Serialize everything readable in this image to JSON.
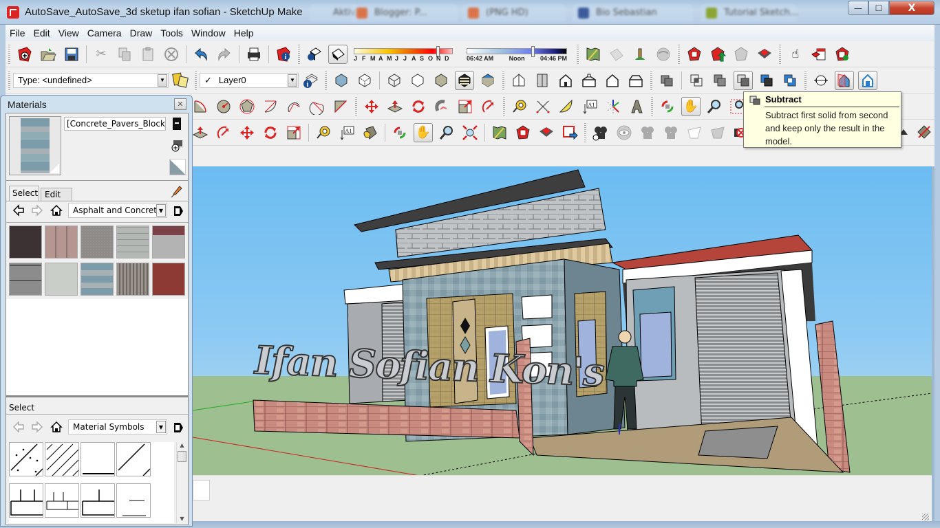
{
  "window": {
    "title": "AutoSave_AutoSave_3d sketup ifan sofian - SketchUp Make",
    "background_tabs": [
      "Aktiv...",
      "Blogger: P...",
      "(PNG HD)",
      "Bio Sebastian",
      "Tutorial Sketch..."
    ],
    "controls": {
      "minimize": "—",
      "maximize": "☐",
      "close": "X"
    }
  },
  "menu": [
    "File",
    "Edit",
    "View",
    "Camera",
    "Draw",
    "Tools",
    "Window",
    "Help"
  ],
  "toolbars": {
    "standard": [
      "new-file",
      "open-file",
      "save",
      "cut",
      "copy",
      "paste",
      "erase",
      "undo",
      "redo",
      "print",
      "model-info"
    ],
    "shadows": {
      "months": [
        "J",
        "F",
        "M",
        "A",
        "M",
        "J",
        "J",
        "A",
        "S",
        "O",
        "N",
        "D"
      ],
      "month_position": 0.85,
      "time_labels": [
        "06:42 AM",
        "Noon",
        "04:46 PM"
      ],
      "time_position": 0.66
    },
    "location": [
      "add-location",
      "toggle-terrain",
      "preview-google-earth",
      "photo-textures"
    ],
    "warehouse": [
      "get-models",
      "share-model",
      "share-component",
      "extension-warehouse"
    ],
    "dynamic_components": [
      "interact",
      "component-options",
      "component-attributes"
    ],
    "type_combo": "Type: <undefined>",
    "layer_combo": {
      "check": "✓",
      "value": "Layer0"
    },
    "tooltip": {
      "title": "Subtract",
      "body": "Subtract first solid from second and keep only the result in the model."
    }
  },
  "materials_panel": {
    "title": "Materials",
    "close": "✕",
    "current_material": "[Concrete_Pavers_Block_",
    "tabs": [
      "Select",
      "Edit"
    ],
    "library": "Asphalt and Concrete",
    "textures": [
      "asphalt-dark",
      "pavers-pink",
      "aggregate-gray",
      "blocks-gray",
      "aggregate-red-band",
      "blocks-stone",
      "concrete-smooth",
      "pavers-blue",
      "concrete-stripes",
      "pavers-red"
    ],
    "secondary_section_label": "Select",
    "secondary_library": "Material Symbols"
  },
  "scene": {
    "sign_text": "Ifan Sofian Kon's",
    "colors": {
      "sky": "#6bbcf2",
      "ground": "#9ebf8f",
      "brick": "#c98a80",
      "tile_wall": "#8fa7b0",
      "roof_red": "#b5453a",
      "dark_roof": "#3e3e3e"
    }
  }
}
